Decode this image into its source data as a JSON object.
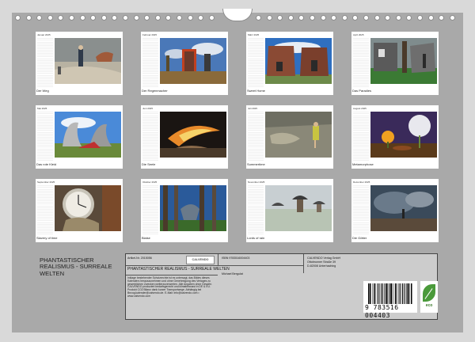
{
  "months": [
    {
      "name": "Januar",
      "caption": "Der Weg",
      "label": "Januar 2025"
    },
    {
      "name": "Februar",
      "caption": "Der Regenmacher",
      "label": "Februar 2025"
    },
    {
      "name": "März",
      "caption": "Sweet Home",
      "label": "März 2025"
    },
    {
      "name": "April",
      "caption": "Das Paradies",
      "label": "April 2025"
    },
    {
      "name": "Mai",
      "caption": "Das rote Kleid",
      "label": "Mai 2025"
    },
    {
      "name": "Juni",
      "caption": "Die Seele",
      "label": "Juni 2025"
    },
    {
      "name": "Juli",
      "caption": "Summertime",
      "label": "Juli 2025"
    },
    {
      "name": "August",
      "caption": "Metamorphose",
      "label": "August 2025"
    },
    {
      "name": "September",
      "caption": "Slavery of time",
      "label": "September 2025"
    },
    {
      "name": "Oktober",
      "caption": "Blaise",
      "label": "Oktober 2025"
    },
    {
      "name": "November",
      "caption": "Lords of rain",
      "label": "November 2025"
    },
    {
      "name": "Dezember",
      "caption": "Die Götter",
      "label": "Dezember 2025"
    }
  ],
  "info": {
    "title": "PHANTASTISCHER REALISMUS - SURREALE WELTEN",
    "article": "Artikel-Nr. 2015056",
    "logo": "CALVENDO",
    "box_title": "PHANTASTISCHER REALISMUS - SURREALE WELTEN",
    "author": "Michael Bergulat",
    "isbn": "ISBN 9783516004403",
    "publisher_name": "CALVENDO Verlag GmbH",
    "publisher_street": "Ottobrunner Straße 39",
    "publisher_city": "D-82008 Unterhaching",
    "description": "Inklage bestehender Schutzrechte ist es untersagt, das Bildes dieses Kalenders herauszunehmen und ohne Genehmigung des Verlages zu gewerblichen Zwecken weiterzuverwerten. Alle Angaben ohne Gewähr. CALVENDO produziert bedarfsgerecht und klimabewusst in DE & EU. Produkt CO2 Bilanz dank kurzer Transportwege. Abhängig bei Bezug.kalender@calvendo.de. E-Mail: info@calvendo.com • www.calvendo.com",
    "barcode_number": "9 783516 004403",
    "eco_label": "eco"
  },
  "colors": {
    "background": "#d9d9d9",
    "sheet": "#a9a9a9",
    "eco_green": "#4a9a3a"
  }
}
